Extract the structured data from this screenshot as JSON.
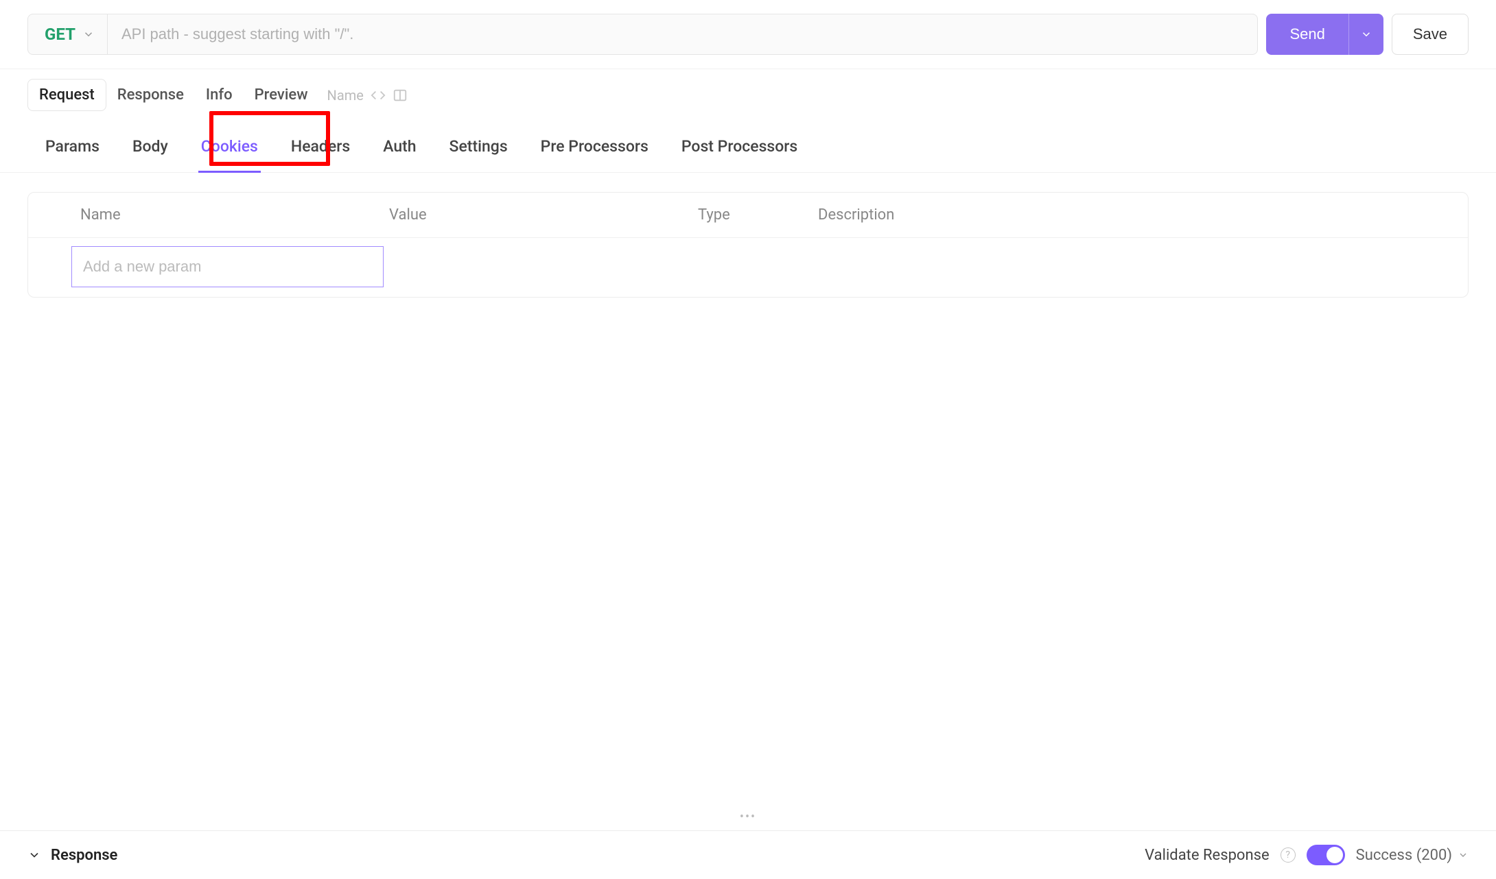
{
  "request_bar": {
    "method": "GET",
    "url_placeholder": "API path - suggest starting with \"/\".",
    "send_label": "Send",
    "save_label": "Save"
  },
  "main_tabs": {
    "items": [
      "Request",
      "Response",
      "Info",
      "Preview"
    ],
    "active_index": 0,
    "name_placeholder": "Name"
  },
  "sub_tabs": {
    "items": [
      "Params",
      "Body",
      "Cookies",
      "Headers",
      "Auth",
      "Settings",
      "Pre Processors",
      "Post Processors"
    ],
    "active_index": 2
  },
  "table": {
    "headers": {
      "name": "Name",
      "value": "Value",
      "type": "Type",
      "description": "Description"
    },
    "new_param_placeholder": "Add a new param"
  },
  "footer": {
    "response_label": "Response",
    "validate_label": "Validate Response",
    "status_label": "Success (200)",
    "toggle_on": true
  }
}
